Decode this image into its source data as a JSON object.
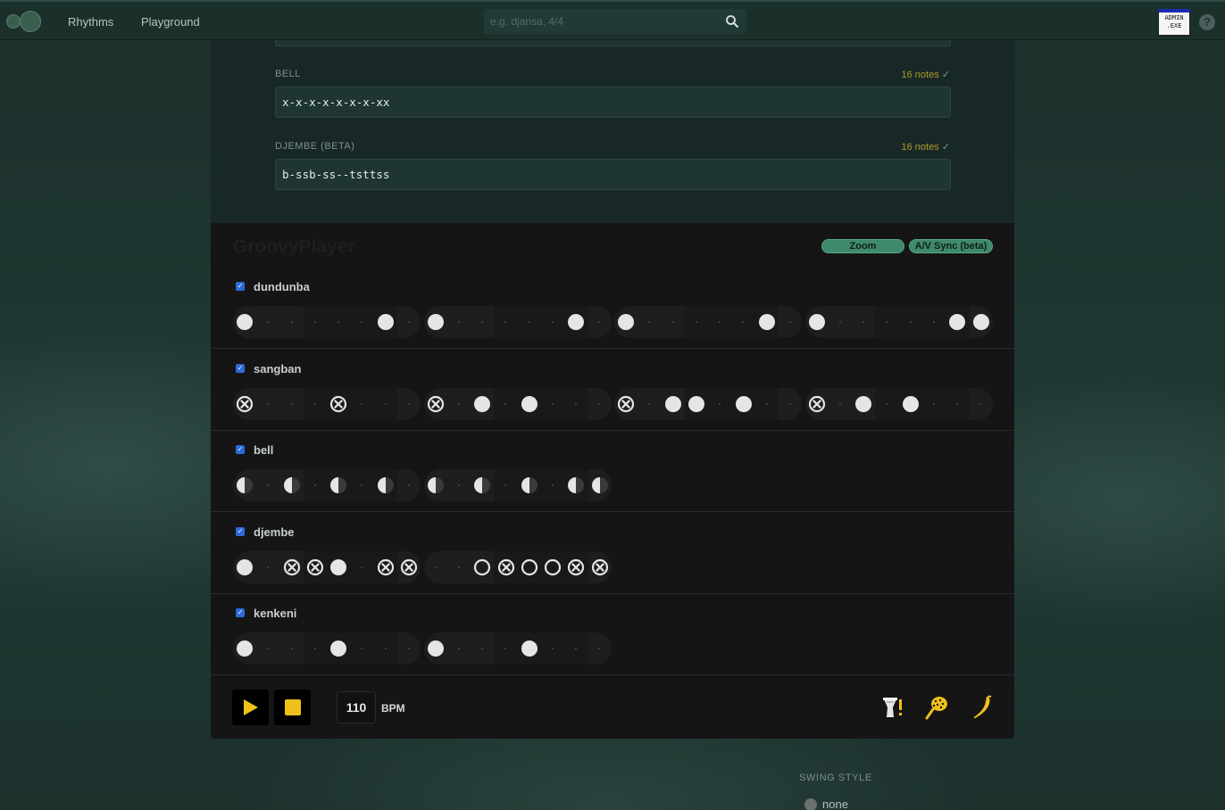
{
  "nav": {
    "links": [
      "Rhythms",
      "Playground"
    ],
    "search_placeholder": "e.g. djansa, 4/4",
    "admin_line1": "ADMIN",
    "admin_line2": ".EXE",
    "help": "?"
  },
  "editor": {
    "fields": [
      {
        "label": "BELL",
        "count": "16 notes",
        "check": "✓",
        "value": "x-x-x-x-x-x-x-xx"
      },
      {
        "label": "DJEMBE (BETA)",
        "count": "16 notes",
        "check": "✓",
        "value": "b-ssb-ss--tsttss"
      }
    ]
  },
  "player": {
    "title": "GroovyPlayer",
    "zoom_label": "Zoom",
    "sync_label": "A/V Sync (beta)",
    "tracks": [
      {
        "name": "dundunba",
        "enabled": true,
        "measures": [
          "f-----f-",
          "f-----f-",
          "f-----f-",
          "f-----ff"
        ]
      },
      {
        "name": "sangban",
        "enabled": true,
        "measures": [
          "x---x---",
          "x-f-f---",
          "x-ff-f--",
          "x-f-f---"
        ]
      },
      {
        "name": "bell",
        "enabled": true,
        "measures": [
          "h-h-h-h-",
          "h-h-h-hh"
        ]
      },
      {
        "name": "djembe",
        "enabled": true,
        "measures": [
          "f-xxf-xx",
          "--oxooxx"
        ]
      },
      {
        "name": "kenkeni",
        "enabled": true,
        "measures": [
          "f---f---",
          "f---f---"
        ]
      }
    ],
    "bpm": "110",
    "bpm_label": "BPM",
    "accent_color": "#f0c01a",
    "tool_icons": [
      "djembe-alert-icon",
      "shaker-icon",
      "chili-pepper-icon"
    ]
  },
  "swing": {
    "label": "SWING STYLE",
    "options": [
      "none"
    ]
  }
}
